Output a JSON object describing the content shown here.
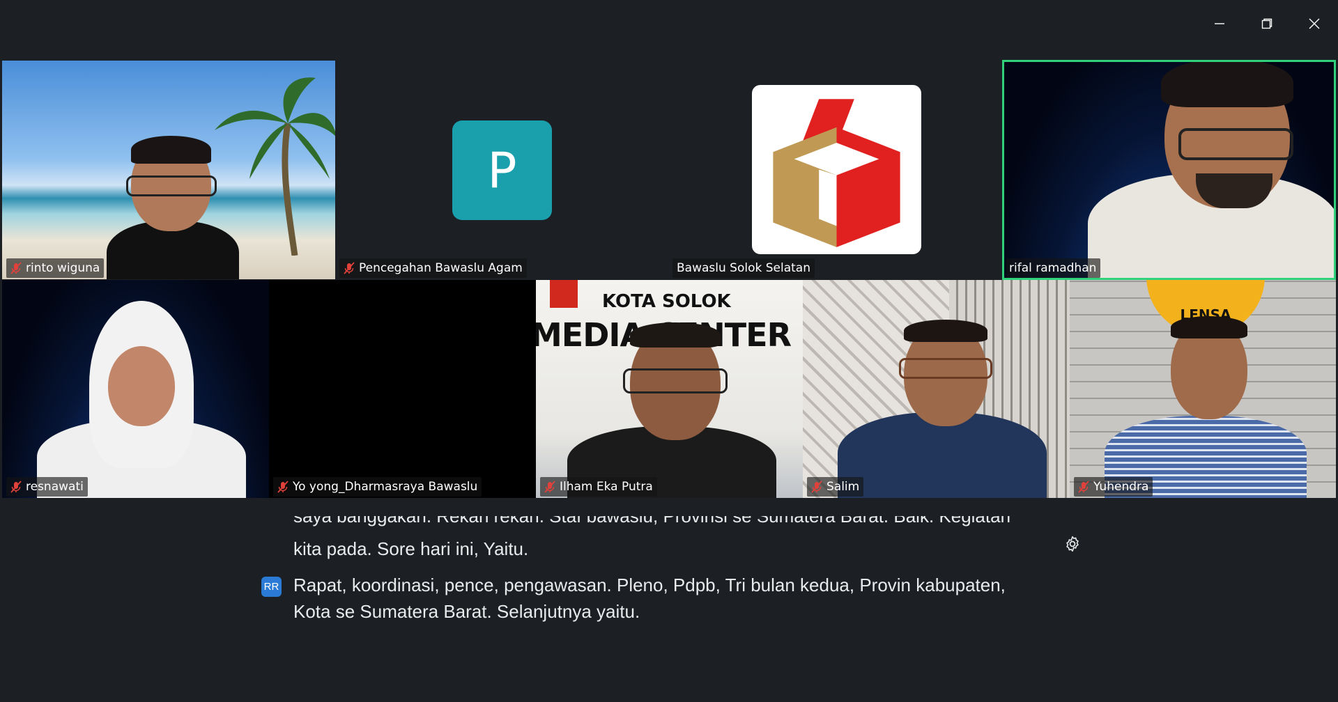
{
  "window": {
    "controls": [
      "minimize-icon",
      "restore-icon",
      "close-icon"
    ]
  },
  "participants": [
    {
      "name": "rinto wiguna",
      "muted": true
    },
    {
      "name": "Pencegahan Bawaslu Agam",
      "muted": true,
      "avatar_letter": "P",
      "avatar_color": "#1aa0ad"
    },
    {
      "name": "Bawaslu Solok Selatan",
      "muted": false
    },
    {
      "name": "rifal ramadhan",
      "muted": false,
      "active_speaker": true
    },
    {
      "name": "resnawati",
      "muted": true
    },
    {
      "name": "Yo yong_Dharmasraya Bawaslu",
      "muted": true
    },
    {
      "name": "Ilham Eka Putra",
      "muted": true
    },
    {
      "name": "Salim",
      "muted": true
    },
    {
      "name": "Yuhendra",
      "muted": true
    }
  ],
  "tile_text": {
    "media_center": "MEDIA CENTER",
    "media_sub": "KOTA SOLOK",
    "lensa": "LENSA"
  },
  "captions": {
    "lines": [
      "saya banggakan. Rekan rekan. Staf bawaslu, Provinsi se Sumatera Barat. Baik. Kegiatan",
      "kita pada. Sore hari ini, Yaitu.",
      "Rapat, koordinasi, pence, pengawasan. Pleno, Pdpb, Tri bulan kedua, Provin kabupaten,",
      "Kota se Sumatera Barat. Selanjutnya yaitu."
    ],
    "speaker_initials": "RR",
    "settings_icon": "gear-icon"
  },
  "colors": {
    "background": "#1c1f23",
    "active_border": "#2fd27a",
    "muted_mic": "#e0413a"
  }
}
